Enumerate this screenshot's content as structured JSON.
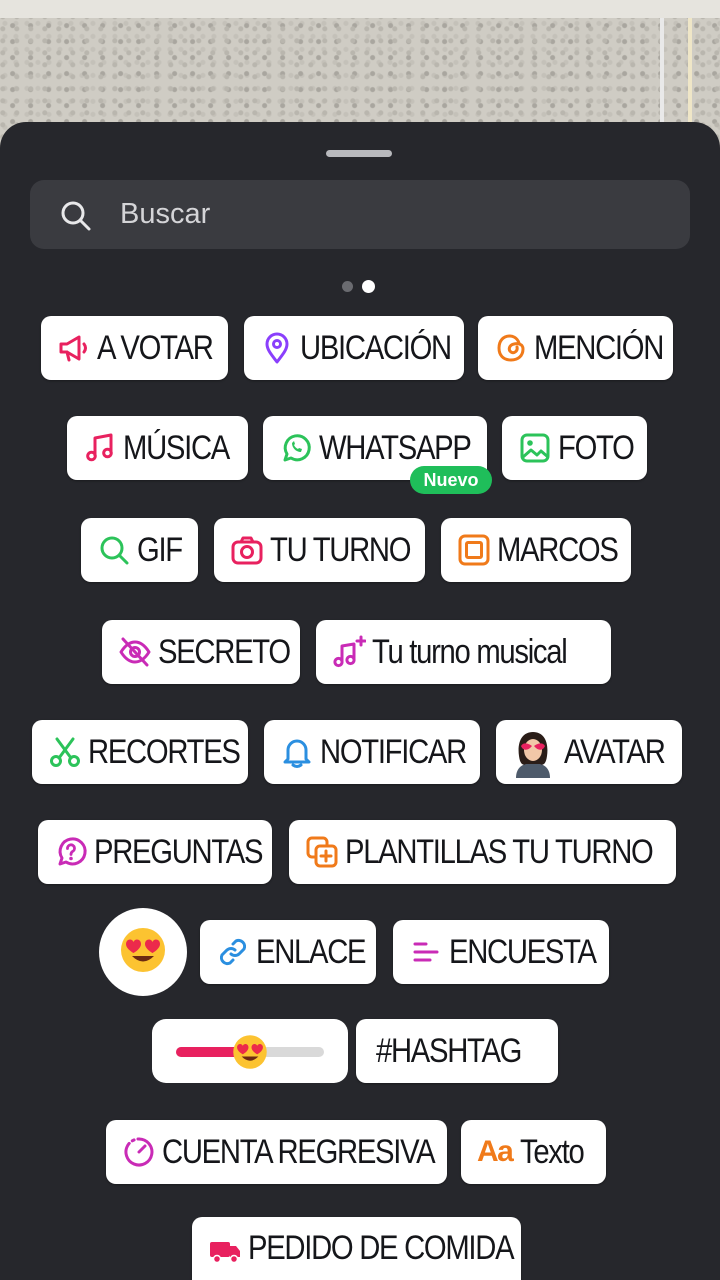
{
  "search": {
    "placeholder": "Buscar"
  },
  "pager": {
    "pages": 2,
    "current": 2
  },
  "stickers": {
    "a_votar": "A VOTAR",
    "ubicacion": "UBICACIÓN",
    "mencion": "MENCIÓN",
    "musica": "MÚSICA",
    "whatsapp": "WHATSAPP",
    "whatsapp_badge": "Nuevo",
    "foto": "FOTO",
    "gif": "GIF",
    "tu_turno": "TU TURNO",
    "marcos": "MARCOS",
    "secreto": "SECRETO",
    "tu_turno_musical": "Tu turno musical",
    "recortes": "RECORTES",
    "notificar": "NOTIFICAR",
    "avatar": "AVATAR",
    "preguntas": "PREGUNTAS",
    "plantillas": "PLANTILLAS TU TURNO",
    "enlace": "ENLACE",
    "encuesta": "ENCUESTA",
    "hashtag": "#HASHTAG",
    "cuenta_regresiva": "CUENTA REGRESIVA",
    "texto_icon": "Aa",
    "texto": "Texto",
    "pedido": "PEDIDO DE COMIDA"
  },
  "emoji_slider": {
    "level": 0.5,
    "emoji": "heart-eyes-emoji"
  },
  "colors": {
    "sheet_bg": "#26272c",
    "search_bg": "#3a3b40",
    "badge_green": "#1fbe5a",
    "pink": "#e8215f",
    "magenta": "#c92bb6",
    "purple": "#8a3ffc",
    "orange": "#f07a1a",
    "green": "#2cc35a",
    "blue": "#2b8fe0"
  }
}
